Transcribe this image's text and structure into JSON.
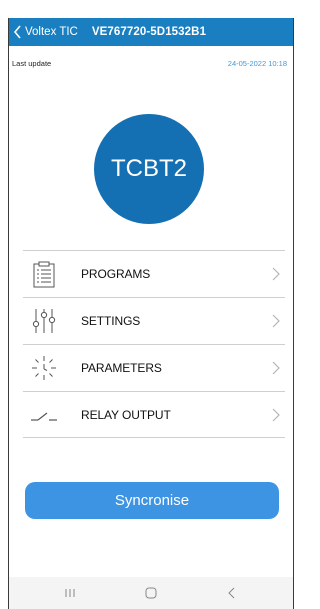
{
  "header": {
    "back_label": "Voltex TIC",
    "device_id": "VE767720-5D1532B1"
  },
  "update": {
    "label": "Last update",
    "value": "24-05-2022 10:18"
  },
  "device": {
    "name": "TCBT2"
  },
  "menu": {
    "items": [
      {
        "label": "PROGRAMS",
        "icon": "clipboard-icon"
      },
      {
        "label": "SETTINGS",
        "icon": "sliders-icon"
      },
      {
        "label": "PARAMETERS",
        "icon": "sun-parameters-icon"
      },
      {
        "label": "RELAY OUTPUT",
        "icon": "relay-switch-icon"
      }
    ]
  },
  "actions": {
    "sync_label": "Syncronise"
  },
  "colors": {
    "header": "#1a7fc1",
    "badge": "#1570b3",
    "button": "#3d94e3",
    "timestamp": "#3d9ae0"
  }
}
